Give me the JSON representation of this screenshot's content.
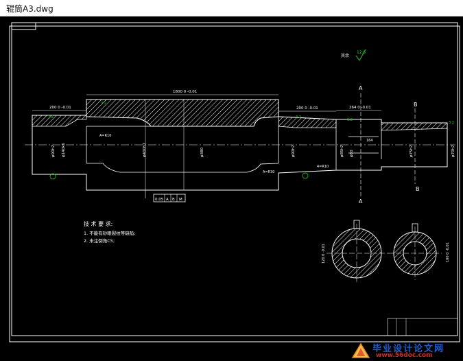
{
  "window": {
    "title": "辊筒A3.dwg"
  },
  "drawing": {
    "surface_finish_label": "其余",
    "surface_finish_value": "12.5",
    "roughness_values": {
      "r1": "3.2",
      "r2": "3.2",
      "r3": "3.2",
      "r4": "3.2",
      "r5": "3.2"
    },
    "section_labels": {
      "a_top": "A",
      "a_bottom": "A",
      "b_top": "B",
      "b_bottom": "B"
    },
    "dims": {
      "overall": "1800 0 -0.01",
      "left_len": "200 0 -0.01",
      "right_len1": "200 0 -0.01",
      "right_len2": "264 0 -0.01",
      "dia_left1": "φ90h7",
      "dia_left2": "φ140k6",
      "dia_mid1": "φ400h7",
      "dia_mid2": "φ380",
      "dia_right1": "φ90h7",
      "dia_right2": "φ85h7",
      "dia_right3": "φ80",
      "dia_end": "φ75h7",
      "dia_end2": "φ70h7",
      "note_a": "A=R10",
      "note_b": "A=R30",
      "note_c": "4=R10",
      "len_k": "164"
    },
    "tolerance_frame": {
      "value": "0.05",
      "datum1": "A",
      "datum2": "B",
      "modifier": "M"
    },
    "tech_req": {
      "title": "技 术 要 求:",
      "line1": "1. 不能有砂眼裂纹等缺陷;",
      "line2": "2. 未注倒角C5;"
    },
    "sections": {
      "dim_a": "120 0 -0.01",
      "dim_b": "100 0 -0.01"
    }
  },
  "watermark": {
    "text": "毕业设计论文网",
    "url": "www.56doc.com"
  },
  "colors": {
    "background": "#000000",
    "outline": "#ffffff",
    "hatch": "#ffffff",
    "datum": "#22cc22"
  }
}
